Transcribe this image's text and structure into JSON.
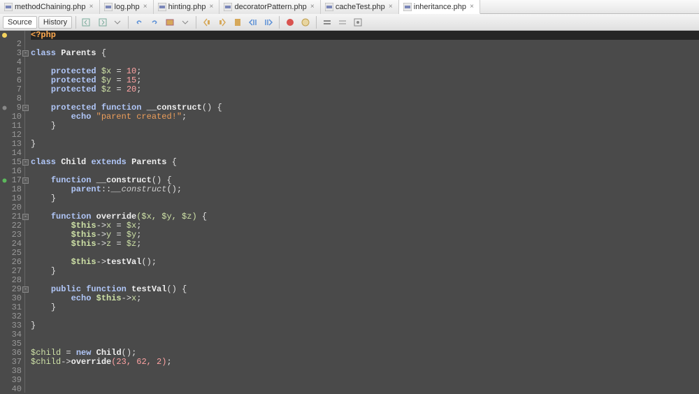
{
  "tabs": [
    {
      "label": "methodChaining.php",
      "active": false
    },
    {
      "label": "log.php",
      "active": false
    },
    {
      "label": "hinting.php",
      "active": false
    },
    {
      "label": "decoratorPattern.php",
      "active": false
    },
    {
      "label": "cacheTest.php",
      "active": false
    },
    {
      "label": "inheritance.php",
      "active": true
    }
  ],
  "toolbar": {
    "source": "Source",
    "history": "History"
  },
  "gutter": {
    "lines": 40,
    "marks": {
      "1": "bulb",
      "9": "dot",
      "17": "green"
    },
    "folds": [
      3,
      9,
      15,
      17,
      21,
      29
    ]
  },
  "code": {
    "open_tag": "<?php",
    "class1": "class",
    "name1": "Parents",
    "brace": "{",
    "prot": "protected",
    "var_x": "$x",
    "eq": "=",
    "n10": "10",
    "semi": ";",
    "var_y": "$y",
    "n15": "15",
    "var_z": "$z",
    "n20": "20",
    "func": "function",
    "construct": "__construct",
    "parens": "()",
    "echo": "echo",
    "str1": "\"parent created!\"",
    "cbrace": "}",
    "child": "Child",
    "extends": "extends",
    "parentcall": "parent",
    "dcolon": "::",
    "construct_it": "__construct",
    "override": "override",
    "args": "($x, $y, $z)",
    "this": "$this",
    "arrow": "->",
    "px": "x",
    "py": "y",
    "pz": "z",
    "testval": "testVal",
    "public": "public",
    "new": "new",
    "childvar": "$child",
    "callargs": "(23, 62, 2)"
  }
}
